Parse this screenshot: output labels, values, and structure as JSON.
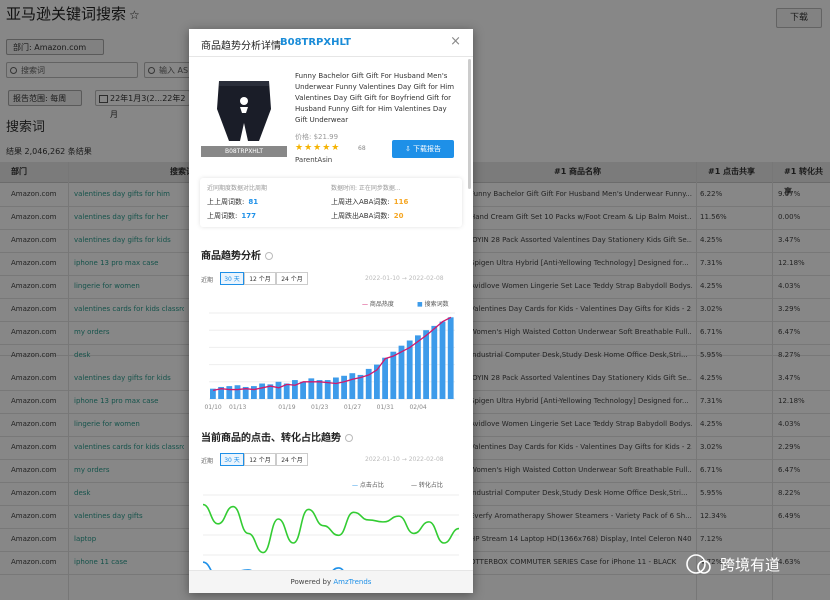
{
  "page": {
    "title": "亚马逊关键词搜索",
    "download_label": "下载",
    "department_label": "部门: Amazon.com",
    "search_placeholder": "搜索词",
    "search2_placeholder": "输入 AS",
    "range_label": "报告范围: 每周",
    "date_label": "22年1月3(2...22年2月",
    "section_title": "搜索词",
    "total": "结果 2,046,262 条结果"
  },
  "table": {
    "headers": {
      "dept": "部门",
      "term": "搜索词",
      "product": "#1 商品名称",
      "click": "#1 点击共享",
      "conv": "#1 转化共享"
    },
    "rows": [
      {
        "dept": "Amazon.com",
        "term": "valentines day gifts for him",
        "product": "Funny Bachelor Gift Gift For Husband Men's Underwear Funny...",
        "click": "6.22%",
        "conv": "9.07%"
      },
      {
        "dept": "Amazon.com",
        "term": "valentines day gifts for her",
        "product": "Hand Cream Gift Set 10 Packs w/Foot Cream & Lip Balm Moist...",
        "click": "11.56%",
        "conv": "0.00%"
      },
      {
        "dept": "Amazon.com",
        "term": "valentines day gifts for kids",
        "product": "JOYIN 28 Pack Assorted Valentines Day Stationery Kids Gift Se...",
        "click": "4.25%",
        "conv": "3.47%"
      },
      {
        "dept": "Amazon.com",
        "term": "iphone 13 pro max case",
        "product": "Spigen Ultra Hybrid [Anti-Yellowing Technology] Designed for...",
        "click": "7.31%",
        "conv": "12.18%"
      },
      {
        "dept": "Amazon.com",
        "term": "lingerie for women",
        "product": "Avidlove Women Lingerie Set Lace Teddy Strap Babydoll Bodys...",
        "click": "4.25%",
        "conv": "4.03%"
      },
      {
        "dept": "Amazon.com",
        "term": "valentines cards for kids classroom",
        "product": "Valentines Day Cards for Kids - Valentines Day Gifts for Kids - 2...",
        "click": "3.02%",
        "conv": "3.29%"
      },
      {
        "dept": "Amazon.com",
        "term": "my orders",
        "product": "Women's High Waisted Cotton Underwear Soft Breathable Full...",
        "click": "6.71%",
        "conv": "6.47%"
      },
      {
        "dept": "Amazon.com",
        "term": "desk",
        "product": "Industrial Computer Desk,Study Desk Home Office Desk,Stri...",
        "click": "5.95%",
        "conv": "8.27%"
      },
      {
        "dept": "Amazon.com",
        "term": "valentines day gifts for kids",
        "product": "JOYIN 28 Pack Assorted Valentines Day Stationery Kids Gift Se...",
        "click": "4.25%",
        "conv": "3.47%"
      },
      {
        "dept": "Amazon.com",
        "term": "iphone 13 pro max case",
        "product": "Spigen Ultra Hybrid [Anti-Yellowing Technology] Designed for...",
        "click": "7.31%",
        "conv": "12.18%"
      },
      {
        "dept": "Amazon.com",
        "term": "lingerie for women",
        "product": "Avidlove Women Lingerie Set Lace Teddy Strap Babydoll Bodys...",
        "click": "4.25%",
        "conv": "4.03%"
      },
      {
        "dept": "Amazon.com",
        "term": "valentines cards for kids classroom",
        "product": "Valentines Day Cards for Kids - Valentines Day Gifts for Kids - 2...",
        "click": "3.02%",
        "conv": "2.29%"
      },
      {
        "dept": "Amazon.com",
        "term": "my orders",
        "product": "Women's High Waisted Cotton Underwear Soft Breathable Full...",
        "click": "6.71%",
        "conv": "6.47%"
      },
      {
        "dept": "Amazon.com",
        "term": "desk",
        "product": "Industrial Computer Desk,Study Desk Home Office Desk,Stri...",
        "click": "5.95%",
        "conv": "8.22%"
      },
      {
        "dept": "Amazon.com",
        "term": "valentines day gifts",
        "product": "Everfy Aromatherapy Shower Steamers - Variety Pack of 6 Sh...",
        "click": "12.34%",
        "conv": "6.49%"
      },
      {
        "dept": "Amazon.com",
        "term": "laptop",
        "product": "HP Stream 14 Laptop HD(1366x768) Display, Intel Celeron N40...",
        "click": "7.12%",
        "conv": ""
      },
      {
        "dept": "Amazon.com",
        "term": "iphone 11 case",
        "product": "OTTERBOX COMMUTER SERIES Case for iPhone 11 - BLACK",
        "click": "4.72%",
        "conv": "4.63%"
      }
    ]
  },
  "modal": {
    "title": "商品趋势分析详情",
    "asin": "B08TRPXHLT",
    "close": "×",
    "product_title": "Funny Bachelor Gift Gift For Husband Men's Underwear Funny Valentines Day Gift for Him Valentines Day Gift Gift for Boyfriend Gift for Husband Funny Gift for Him Valentines Day Gift Underwear",
    "price": "价格: $21.99",
    "stars": "★★★★★",
    "reviews": "68",
    "parent": "ParentAsin",
    "report_btn": "下载报告",
    "stats_h1": "近同期度数据对比周期",
    "stats_h2": "数据时间: 正在同步数据...",
    "s1_label": "上上周词数:",
    "s1_val": "81",
    "s2_label": "上周词数:",
    "s2_val": "177",
    "s3_label": "上周进入ABA词数:",
    "s3_val": "116",
    "s4_label": "上周跌出ABA词数:",
    "s4_val": "20",
    "trend_title": "商品趋势分析",
    "range_lbl": "近期",
    "seg_30": "30 天",
    "seg_12": "12 个月",
    "seg_24": "24 个月",
    "date_range": "2022-01-10 → 2022-02-08",
    "legend_line": "商品热度",
    "legend_bar": "搜索词数",
    "share_title": "当前商品的点击、转化占比趋势",
    "legend_click": "点击占比",
    "legend_conv": "转化占比",
    "footer_prefix": "Powered by ",
    "footer_brand": "AmzTrends",
    "colors": {
      "accent": "#1e90e8",
      "line": "#d2186b",
      "bar": "#3d9bea",
      "green": "#33cc33"
    }
  },
  "chart_data": [
    {
      "type": "bar",
      "categories": [
        "01/10",
        "01/11",
        "01/12",
        "01/13",
        "01/14",
        "01/15",
        "01/16",
        "01/17",
        "01/18",
        "01/19",
        "01/20",
        "01/21",
        "01/22",
        "01/23",
        "01/24",
        "01/25",
        "01/26",
        "01/27",
        "01/28",
        "01/29",
        "01/30",
        "01/31",
        "02/01",
        "02/02",
        "02/03",
        "02/04",
        "02/05",
        "02/06",
        "02/07",
        "02/08"
      ],
      "x_tick_labels": [
        "01/10",
        "01/13",
        "01/19",
        "01/23",
        "01/27",
        "01/31",
        "02/04"
      ],
      "series": [
        {
          "name": "搜索词数",
          "values": [
            12,
            14,
            15,
            16,
            14,
            15,
            18,
            17,
            20,
            18,
            22,
            20,
            24,
            22,
            22,
            25,
            27,
            30,
            28,
            35,
            40,
            48,
            55,
            62,
            68,
            74,
            80,
            85,
            90,
            95
          ]
        },
        {
          "name": "商品热度",
          "values": [
            10,
            12,
            11,
            11,
            12,
            11,
            13,
            15,
            13,
            17,
            16,
            20,
            20,
            20,
            19,
            18,
            20,
            23,
            25,
            28,
            34,
            47,
            50,
            55,
            60,
            67,
            74,
            82,
            90,
            95
          ]
        }
      ],
      "ylim": [
        0,
        100
      ]
    },
    {
      "type": "line",
      "series": [
        {
          "name": "点击占比",
          "values": [
            90,
            70,
            88,
            60,
            40,
            75,
            50,
            85,
            68,
            58,
            82,
            74,
            72,
            78,
            60,
            72,
            50,
            65
          ]
        },
        {
          "name": "转化占比",
          "values": [
            30,
            15,
            20,
            22,
            12,
            5,
            20,
            12,
            14,
            24,
            8,
            18,
            12,
            10,
            18,
            8,
            14,
            6
          ]
        }
      ],
      "ylim": [
        0,
        100
      ]
    }
  ]
}
